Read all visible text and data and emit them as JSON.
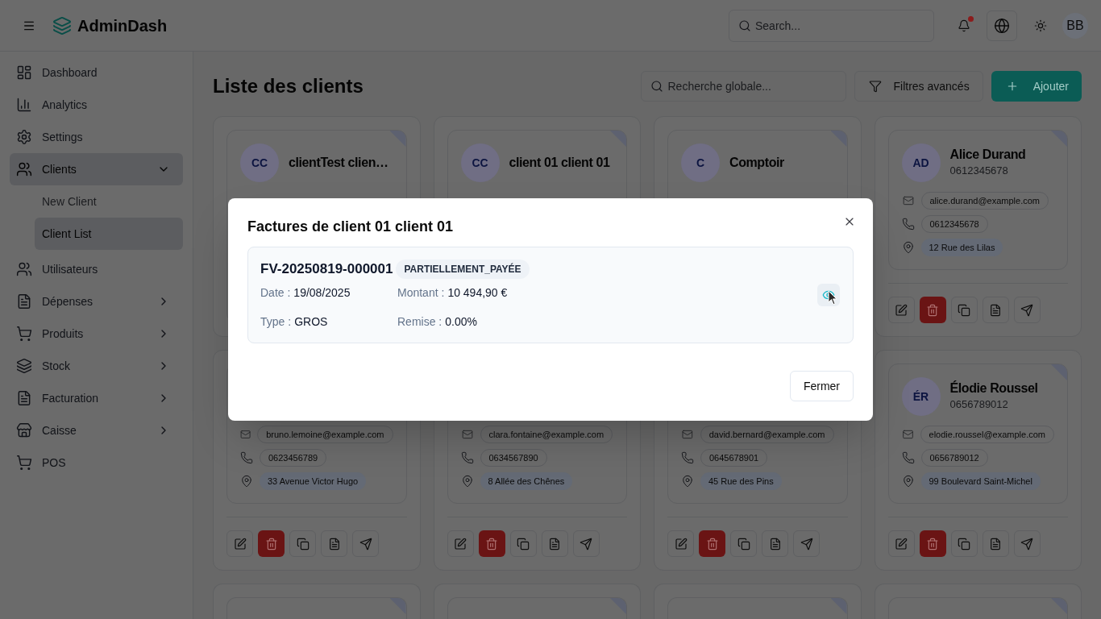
{
  "header": {
    "app_name": "AdminDash",
    "search": {
      "placeholder": "Search..."
    },
    "notifications": {
      "unread": true
    },
    "user_initials": "BB"
  },
  "sidebar": {
    "items": [
      {
        "label": "Dashboard",
        "kind": "link",
        "selected": false
      },
      {
        "label": "Analytics",
        "kind": "link",
        "selected": false
      },
      {
        "label": "Settings",
        "kind": "link",
        "selected": false
      },
      {
        "label": "Clients",
        "kind": "group",
        "selected": true,
        "expanded": true,
        "children": [
          {
            "label": "New Client",
            "selected": false
          },
          {
            "label": "Client List",
            "selected": true
          }
        ]
      },
      {
        "label": "Utilisateurs",
        "kind": "link",
        "selected": false
      },
      {
        "label": "Dépenses",
        "kind": "group",
        "selected": false,
        "expanded": false
      },
      {
        "label": "Produits",
        "kind": "group",
        "selected": false,
        "expanded": false
      },
      {
        "label": "Stock",
        "kind": "group",
        "selected": false,
        "expanded": false
      },
      {
        "label": "Facturation",
        "kind": "group",
        "selected": false,
        "expanded": false
      },
      {
        "label": "Caisse",
        "kind": "group",
        "selected": false,
        "expanded": false
      },
      {
        "label": "POS",
        "kind": "link",
        "selected": false
      }
    ]
  },
  "page": {
    "title": "Liste des clients",
    "search": {
      "placeholder": "Recherche globale..."
    },
    "buttons": [
      {
        "label": "Filtres avancés",
        "kind": "outline"
      },
      {
        "label": "Ajouter",
        "kind": "primary"
      }
    ]
  },
  "clients": [
    {
      "kind": "header",
      "initials": "CC",
      "name": "clientTest clien…"
    },
    {
      "kind": "header",
      "initials": "CC",
      "name": "client 01 client 01"
    },
    {
      "kind": "header",
      "initials": "C",
      "name": "Comptoir"
    },
    {
      "kind": "full",
      "initials": "AD",
      "name": "Alice Durand",
      "subtitle": "0612345678",
      "email": "alice.durand@example.com",
      "phone": "0612345678",
      "address": "12 Rue des Lilas"
    },
    {
      "kind": "details",
      "email": "bruno.lemoine@example.com",
      "phone": "0623456789",
      "address": "33 Avenue Victor Hugo"
    },
    {
      "kind": "details",
      "email": "clara.fontaine@example.com",
      "phone": "0634567890",
      "address": "8 Allée des Chênes"
    },
    {
      "kind": "details",
      "email": "david.bernard@example.com",
      "phone": "0645678901",
      "address": "45 Rue des Pins"
    },
    {
      "kind": "full",
      "initials": "ÉR",
      "name": "Élodie Roussel",
      "subtitle": "0656789012",
      "email": "elodie.roussel@example.com",
      "phone": "0656789012",
      "address": "99 Boulevard Saint-Michel"
    },
    {
      "kind": "edge"
    },
    {
      "kind": "edge"
    },
    {
      "kind": "edge"
    },
    {
      "kind": "edge"
    }
  ],
  "dialog": {
    "title": "Factures de client 01 client 01",
    "invoices": [
      {
        "number": "FV-20250819-000001",
        "status": "PARTIELLEMENT_PAYÉE",
        "fields": [
          {
            "label": "Date :",
            "value": "19/08/2025"
          },
          {
            "label": "Montant :",
            "value": "10 494,90 €"
          },
          {
            "label": "Type :",
            "value": "GROS"
          },
          {
            "label": "Remise :",
            "value": "0.00%"
          }
        ]
      }
    ],
    "buttons": [
      "Fermer"
    ]
  }
}
